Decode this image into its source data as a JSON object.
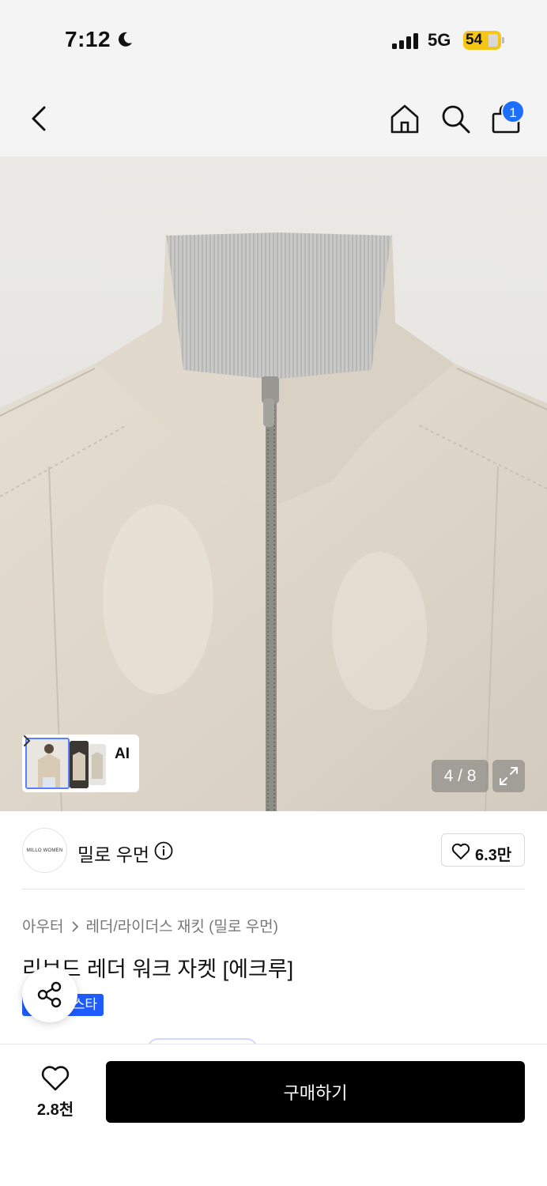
{
  "status": {
    "time": "7:12",
    "network": "5G",
    "battery": "54"
  },
  "nav": {
    "cart_count": "1"
  },
  "gallery": {
    "ai_label": "AI",
    "counter": "4 / 8"
  },
  "brand": {
    "logo_text": "MILLO WOMEN",
    "name": "밀로 우먼",
    "likes": "6.3만"
  },
  "breadcrumb": {
    "level1": "아우터",
    "level2": "레더/라이더스 재킷 (밀로 우먼)"
  },
  "product": {
    "title": "리브드 레더 워크 자켓 [에크루]",
    "badge": "스타"
  },
  "bottom": {
    "wish_count": "2.8천",
    "buy_label": "구매하기"
  },
  "colors": {
    "accent": "#1f6fff",
    "badge": "#1f5cff",
    "battery": "#f5c518"
  }
}
